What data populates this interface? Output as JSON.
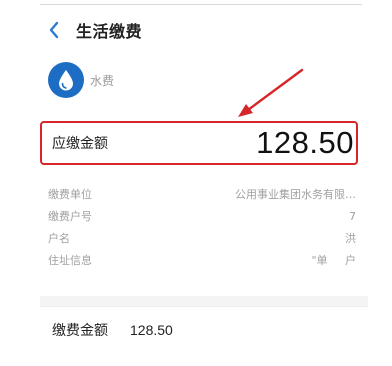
{
  "header": {
    "title": "生活缴费"
  },
  "biz": {
    "label": "水费",
    "icon": "water-drop-icon"
  },
  "amount": {
    "label": "应缴金额",
    "value": "128.50"
  },
  "details": [
    {
      "label": "缴费单位",
      "value": "公用事业集团水务有限…"
    },
    {
      "label": "缴费户号",
      "value": "7"
    },
    {
      "label": "户名",
      "value": "洪"
    },
    {
      "label": "住址信息",
      "value": "\"单     户"
    }
  ],
  "pay": {
    "label": "缴费金额",
    "value": "128.50"
  },
  "colors": {
    "accent": "#1e6dc5",
    "highlight": "#d7262a",
    "back": "#2a7bd3"
  }
}
